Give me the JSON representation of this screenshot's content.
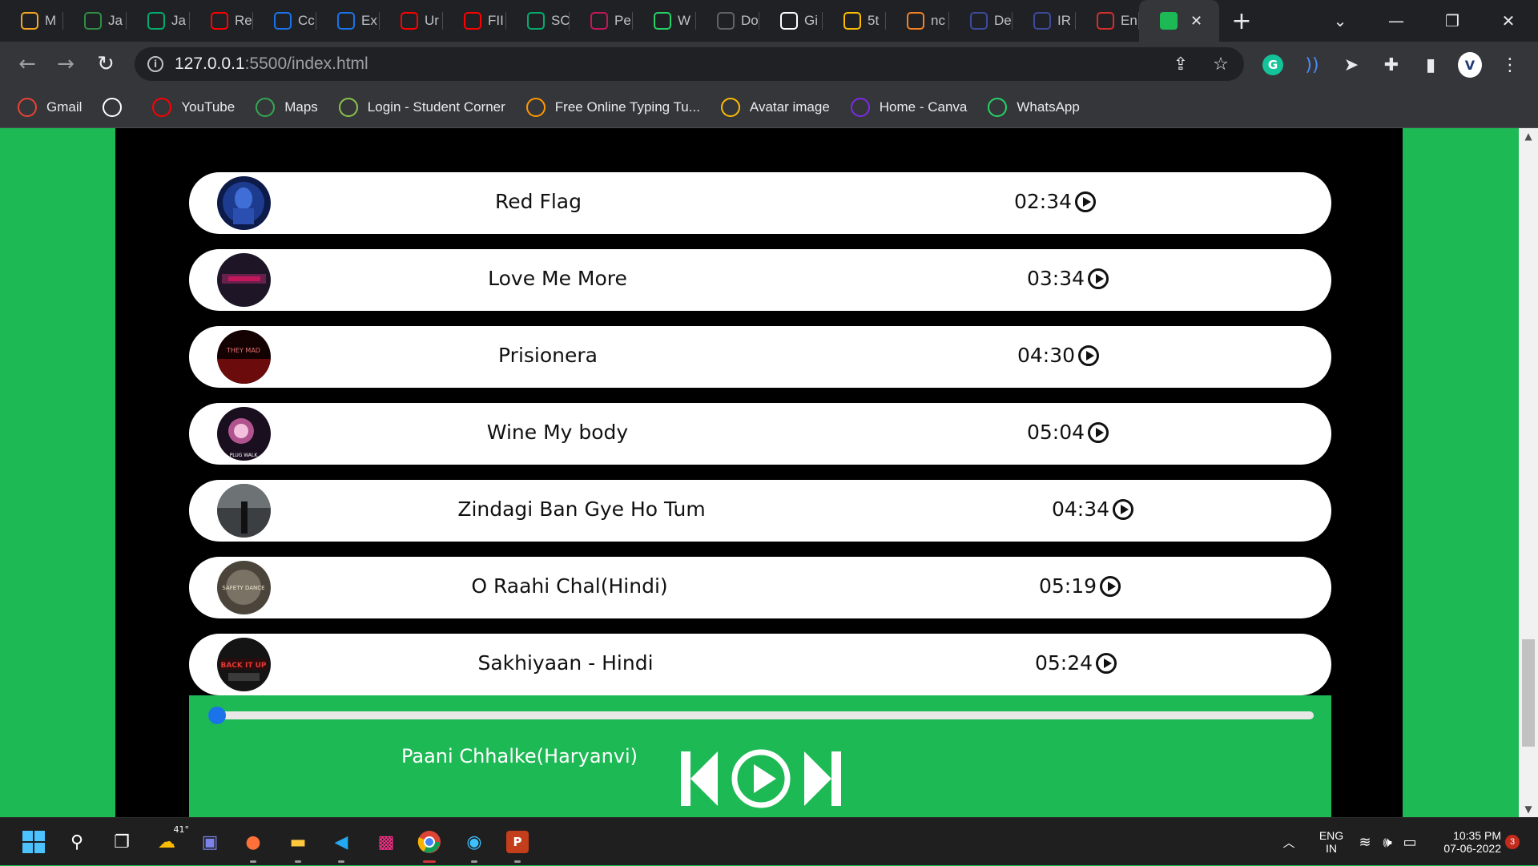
{
  "browser": {
    "tabs": [
      {
        "label": "M",
        "icon": "medium-icon",
        "color": "#f5a623"
      },
      {
        "label": "Ja",
        "icon": "geeksforgeeks-icon",
        "color": "#2f8d46"
      },
      {
        "label": "Ja",
        "icon": "w3schools-icon",
        "color": "#04aa6d"
      },
      {
        "label": "Re",
        "icon": "youtube-icon",
        "color": "#ff0000"
      },
      {
        "label": "Cc",
        "icon": "c-icon",
        "color": "#1a73e8"
      },
      {
        "label": "Ex",
        "icon": "c-icon",
        "color": "#1a73e8"
      },
      {
        "label": "Ur",
        "icon": "youtube-icon",
        "color": "#ff0000"
      },
      {
        "label": "FII",
        "icon": "youtube-icon",
        "color": "#ff0000"
      },
      {
        "label": "SC",
        "icon": "w3schools-icon",
        "color": "#04aa6d"
      },
      {
        "label": "Pe",
        "icon": "box-icon",
        "color": "#c2185b"
      },
      {
        "label": "W",
        "icon": "whatsapp-icon",
        "color": "#25d366"
      },
      {
        "label": "Do",
        "icon": "download-icon",
        "color": "#5f6368"
      },
      {
        "label": "Gi",
        "icon": "github-icon",
        "color": "#ffffff"
      },
      {
        "label": "5t",
        "icon": "drive-icon",
        "color": "#fbbc04"
      },
      {
        "label": "nc",
        "icon": "stackoverflow-icon",
        "color": "#f48024"
      },
      {
        "label": "De",
        "icon": "doc-icon",
        "color": "#3c4b9b"
      },
      {
        "label": "IR",
        "icon": "doc-icon",
        "color": "#3c4b9b"
      },
      {
        "label": "En",
        "icon": "avatar-icon",
        "color": "#d32f2f"
      }
    ],
    "active_tab": {
      "icon": "spotify-shield-icon",
      "close": "✕"
    },
    "new_tab": "+",
    "url_host": "127.0.0.1",
    "url_rest": ":5500/index.html",
    "bookmarks": [
      {
        "label": "Gmail",
        "icon": "gmail-icon",
        "color": "#ea4335"
      },
      {
        "label": "",
        "icon": "github-icon",
        "color": "#ffffff"
      },
      {
        "label": "YouTube",
        "icon": "youtube-icon",
        "color": "#ff0000"
      },
      {
        "label": "Maps",
        "icon": "maps-icon",
        "color": "#34a853"
      },
      {
        "label": "Login - Student Corner",
        "icon": "student-corner-icon",
        "color": "#8bc34a"
      },
      {
        "label": "Free Online Typing Tu...",
        "icon": "typing-icon",
        "color": "#ff9800"
      },
      {
        "label": "Avatar image",
        "icon": "photos-icon",
        "color": "#fbbc04"
      },
      {
        "label": "Home - Canva",
        "icon": "canva-icon",
        "color": "#7d2ae8"
      },
      {
        "label": "WhatsApp",
        "icon": "whatsapp-icon",
        "color": "#25d366"
      }
    ]
  },
  "songs": [
    {
      "title": "Red Flag",
      "duration": "02:34",
      "cover_color": "#1d3c8f"
    },
    {
      "title": "Love Me More",
      "duration": "03:34",
      "cover_color": "#2a1b33"
    },
    {
      "title": "Prisionera",
      "duration": "04:30",
      "cover_color": "#3a0a0a"
    },
    {
      "title": "Wine My body",
      "duration": "05:04",
      "cover_color": "#2b1730"
    },
    {
      "title": "Zindagi Ban Gye Ho Tum",
      "duration": "04:34",
      "cover_color": "#5a5e60"
    },
    {
      "title": "O Raahi Chal(Hindi)",
      "duration": "05:19",
      "cover_color": "#6b6356"
    },
    {
      "title": "Sakhiyaan - Hindi",
      "duration": "05:24",
      "cover_color": "#1a1a1a"
    }
  ],
  "cover_text": {
    "prisionera": "THEY MAD",
    "wine": "PLUG WALK",
    "raahi": "SAFETY DANCE",
    "sakhiyaan": "BACK IT UP"
  },
  "player": {
    "now_playing": "Paani Chhalke(Haryanvi)",
    "progress": 0,
    "accent": "#1db954"
  },
  "taskbar": {
    "weather": "41°",
    "lang": "ENG",
    "region": "IN",
    "time": "10:35 PM",
    "date": "07-06-2022",
    "notifications": "3"
  }
}
